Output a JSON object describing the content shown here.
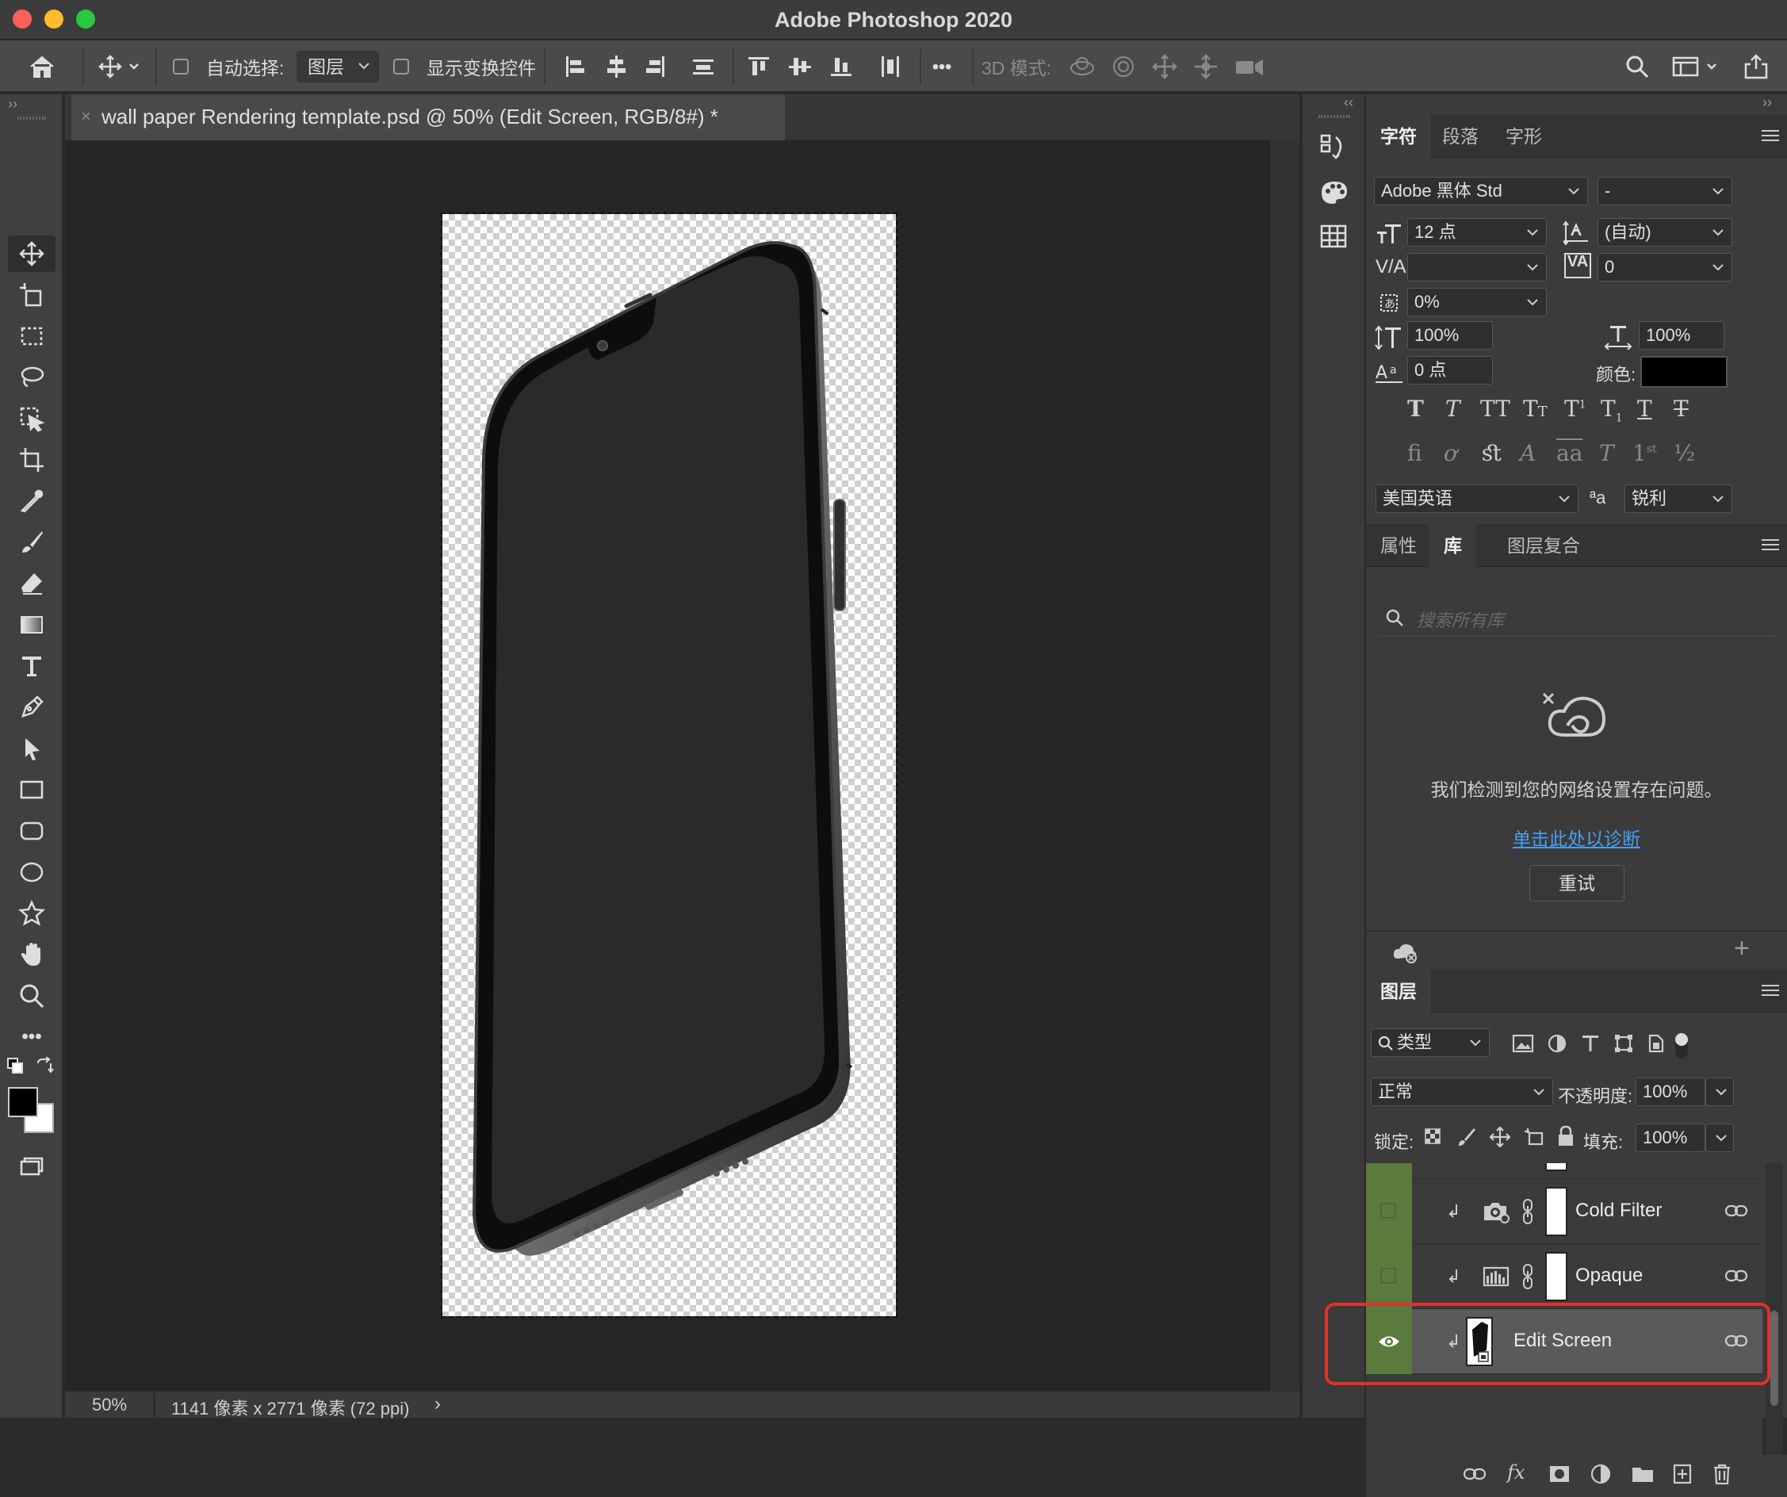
{
  "window": {
    "title": "Adobe Photoshop 2020"
  },
  "options_bar": {
    "auto_select_label": "自动选择:",
    "auto_select_target": "图层",
    "show_transform_label": "显示变换控件",
    "more_label": "•••",
    "mode_3d_label": "3D 模式:"
  },
  "document": {
    "tab_title": "wall paper Rendering template.psd @ 50% (Edit Screen, RGB/8#) *",
    "zoom": "50%",
    "info": "1141 像素 x 2771 像素 (72 ppi)",
    "info_arrow": "›"
  },
  "character_panel": {
    "tabs": [
      "字符",
      "段落",
      "字形"
    ],
    "active_tab": "字符",
    "font_family": "Adobe 黑体 Std",
    "font_style": "-",
    "font_size": "12 点",
    "leading": "(自动)",
    "kerning": "",
    "tracking": "0",
    "tsume": "0%",
    "vertical_scale": "100%",
    "horizontal_scale": "100%",
    "baseline_shift": "0 点",
    "color_label": "颜色:",
    "color_value": "#000000",
    "language": "美国英语",
    "aa_label": "ªa",
    "antialias": "锐利"
  },
  "library_panel": {
    "tabs": [
      "属性",
      "库",
      "图层复合"
    ],
    "active_tab": "库",
    "search_placeholder": "搜索所有库",
    "message": "我们检测到您的网络设置存在问题。",
    "diagnose_link": "单击此处以诊断",
    "retry_label": "重试",
    "add_label": "+"
  },
  "layers_panel": {
    "tab": "图层",
    "filter_kind": "类型",
    "blend_mode": "正常",
    "opacity_label": "不透明度:",
    "opacity": "100%",
    "lock_label": "锁定:",
    "fill_label": "填充:",
    "fill": "100%",
    "layers": [
      {
        "name": "Cold Filter",
        "visible": false,
        "selected": false
      },
      {
        "name": "Opaque",
        "visible": false,
        "selected": false
      },
      {
        "name": "Edit Screen",
        "visible": true,
        "selected": true
      }
    ]
  },
  "colors": {
    "accent_link": "#4a9ef0",
    "highlight_box": "#e0312a",
    "visibility_column": "#5b7a3e"
  }
}
